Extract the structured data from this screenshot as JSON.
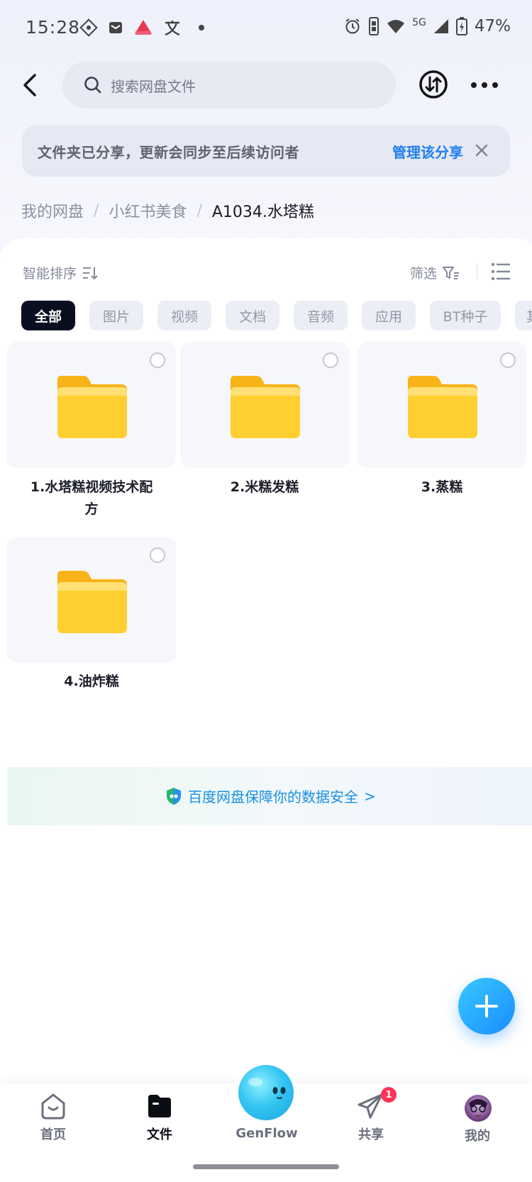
{
  "status_bar": {
    "time": "15:28",
    "battery": "47%",
    "network": "5G",
    "icons": [
      "signal-diamond-icon",
      "mail-icon",
      "app-red-icon",
      "translate-icon",
      "dot-icon",
      "alarm-icon",
      "vibrate-icon",
      "wifi-icon",
      "cellular-icon",
      "battery-icon"
    ]
  },
  "top_bar": {
    "search_placeholder": "搜索网盘文件"
  },
  "share_banner": {
    "text": "文件夹已分享，更新会同步至后续访问者",
    "link": "管理该分享"
  },
  "breadcrumb": {
    "items": [
      "我的网盘",
      "小红书美食"
    ],
    "current": "A1034.水塔糕"
  },
  "toolbar": {
    "sort_label": "智能排序",
    "filter_label": "筛选"
  },
  "filter_chips": [
    "全部",
    "图片",
    "视频",
    "文档",
    "音频",
    "应用",
    "BT种子",
    "其"
  ],
  "folders": [
    {
      "name_line1": "1.水塔糕视频技术配",
      "name_line2": "方"
    },
    {
      "name_line1": "2.米糕发糕",
      "name_line2": ""
    },
    {
      "name_line1": "3.蒸糕",
      "name_line2": ""
    },
    {
      "name_line1": "4.油炸糕",
      "name_line2": ""
    }
  ],
  "security_banner": {
    "text": "百度网盘保障你的数据安全",
    "chevron": ">"
  },
  "bottom_nav": {
    "home": "首页",
    "files": "文件",
    "genflow": "GenFlow",
    "share": "共享",
    "share_badge": "1",
    "mine": "我的"
  },
  "colors": {
    "accent_blue": "#1f7ff0",
    "chip_active_bg": "#0a0f1f",
    "folder_yellow": "#ffc82a",
    "badge_red": "#ff3355"
  }
}
